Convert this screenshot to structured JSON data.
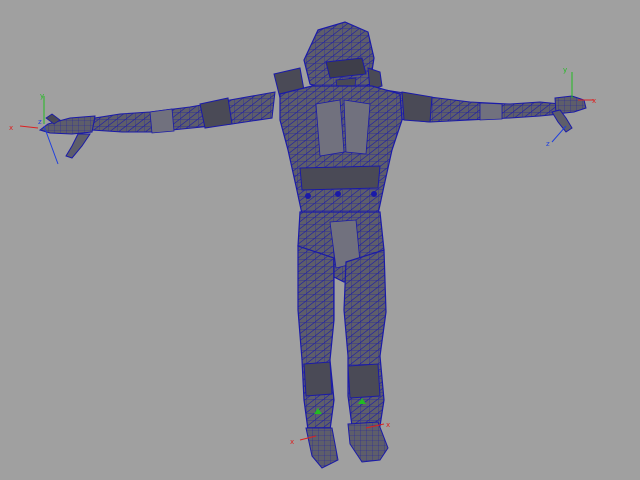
{
  "viewport": {
    "background_color": "#a0a0a0",
    "mesh": {
      "name": "armored-character-tpose",
      "fill_color": "#5e5e6a",
      "fill_dark": "#4a4a56",
      "fill_light": "#71717e",
      "wire_color": "#1a1aa8"
    },
    "axis_colors": {
      "x": "#dd2020",
      "y": "#22bb22",
      "z": "#2040dd"
    },
    "gizmos": [
      {
        "id": "left-hand",
        "axes": [
          {
            "letter": "x"
          },
          {
            "letter": "y"
          },
          {
            "letter": "z"
          }
        ]
      },
      {
        "id": "right-hand",
        "axes": [
          {
            "letter": "x"
          },
          {
            "letter": "y"
          },
          {
            "letter": "z"
          }
        ]
      },
      {
        "id": "left-foot",
        "axes": [
          {
            "letter": "x"
          }
        ]
      },
      {
        "id": "right-foot",
        "axes": [
          {
            "letter": "x"
          }
        ]
      }
    ]
  }
}
